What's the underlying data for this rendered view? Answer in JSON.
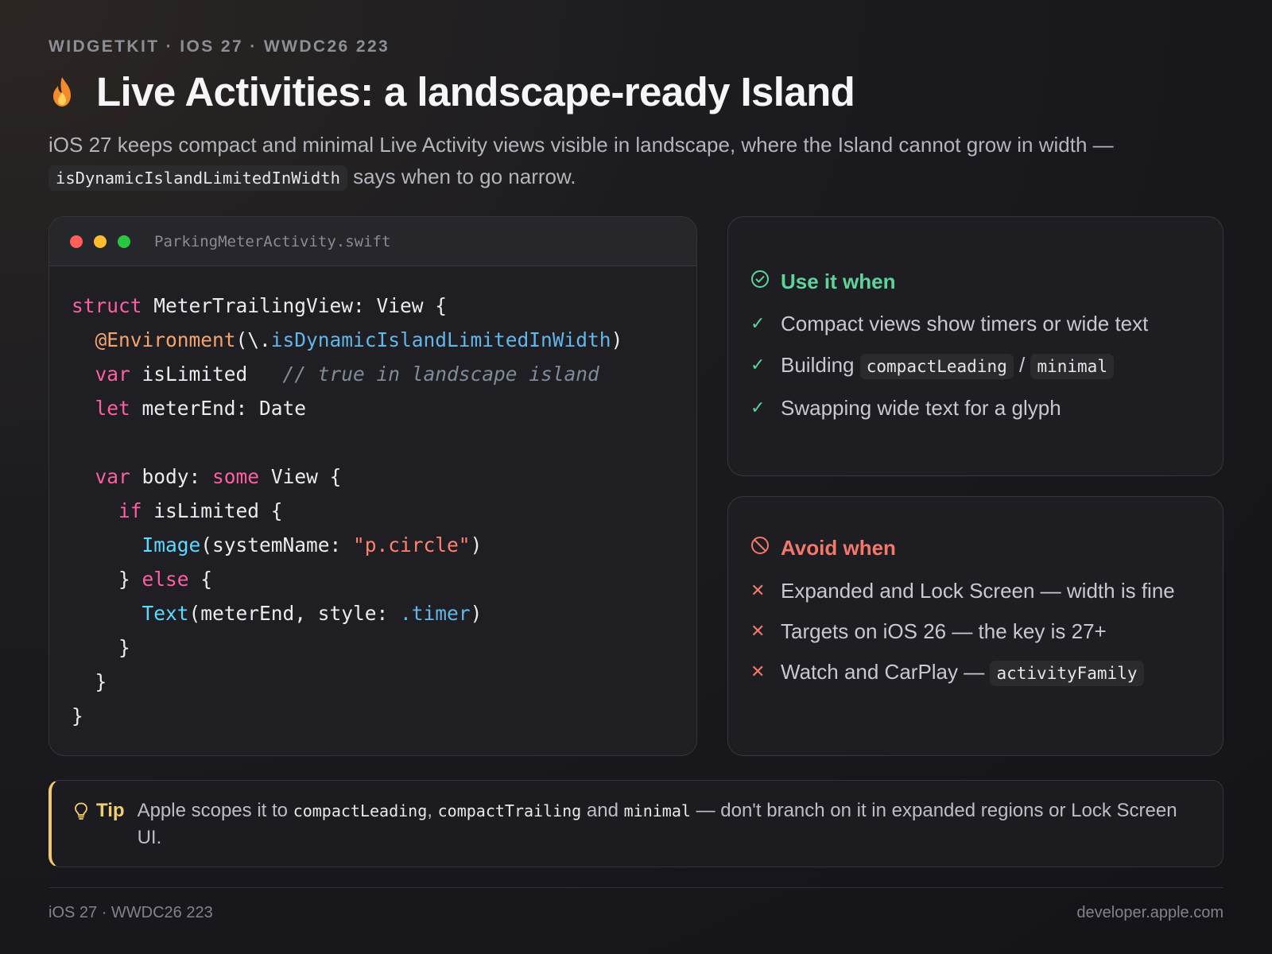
{
  "eyebrow": "WIDGETKIT · IOS 27 · WWDC26 223",
  "title": "Live Activities: a landscape-ready Island",
  "lede": {
    "text_a": "iOS 27 keeps compact and minimal Live Activity views visible in landscape, where the Island cannot grow in width —",
    "code": "isDynamicIslandLimitedInWidth",
    "text_b": "says when to go narrow."
  },
  "code_card": {
    "filename": "ParkingMeterActivity.swift",
    "lines": {
      "l1": [
        "struct",
        " MeterTrailingView: View {"
      ],
      "l2": [
        "@Environment",
        "(\\.",
        "isDynamicIslandLimitedInWidth",
        ")"
      ],
      "l3": [
        "var",
        " isLimited   ",
        "// true in landscape island"
      ],
      "l4": [
        "let",
        " meterEnd: Date"
      ],
      "l6": [
        "var",
        " body: ",
        "some",
        " View {"
      ],
      "l7": [
        "if",
        " isLimited {"
      ],
      "l8": [
        "Image",
        "(systemName: ",
        "\"p.circle\"",
        ")"
      ],
      "l9": [
        "} ",
        "else",
        " {"
      ],
      "l10": [
        "Text",
        "(meterEnd, style: ",
        ".timer",
        ")"
      ],
      "l11": "}",
      "l12": "}",
      "l13": "}"
    }
  },
  "use_card": {
    "title": "Use it when",
    "items": [
      {
        "text": "Compact views show timers or wide text"
      },
      {
        "text_a": "Building",
        "code_a": "compactLeading",
        "sep": "/",
        "code_b": "minimal"
      },
      {
        "text": "Swapping wide text for a glyph"
      }
    ],
    "mark": "✓",
    "color": "#5fd49a"
  },
  "avoid_card": {
    "title": "Avoid when",
    "items": [
      {
        "text": "Expanded and Lock Screen — width is fine"
      },
      {
        "text": "Targets on iOS 26 — the key is 27+"
      },
      {
        "text_a": "Watch and CarPlay —",
        "code": "activityFamily"
      }
    ],
    "mark": "✕",
    "color": "#f2786c"
  },
  "tip": {
    "label": "Tip",
    "t1": "Apple scopes it to",
    "c1": "compactLeading",
    "t2": ",",
    "c2": "compactTrailing",
    "t3": "and",
    "c3": "minimal",
    "t4": "— don't branch on it in expanded regions or Lock Screen UI.",
    "color": "#f2ce72"
  },
  "footer": {
    "left": "iOS 27 · WWDC26 223",
    "right": "developer.apple.com"
  },
  "icons": {
    "title": "flame-icon",
    "use": "check-circle-icon",
    "avoid": "prohibited-icon",
    "tip": "lightbulb-icon"
  }
}
